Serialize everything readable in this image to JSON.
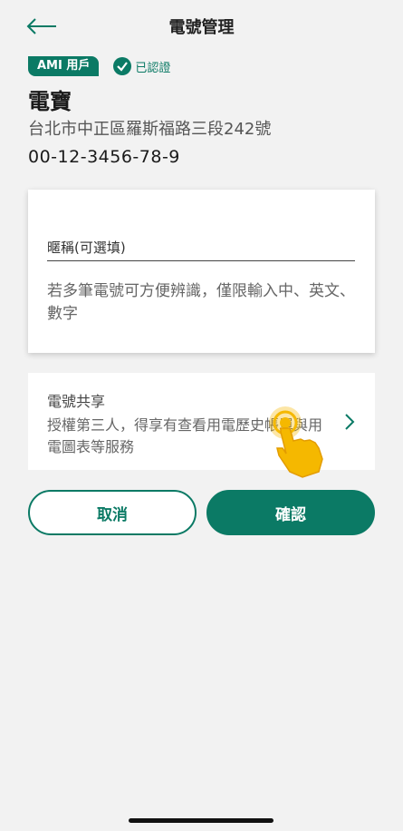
{
  "header": {
    "title": "電號管理"
  },
  "account": {
    "badge": "AMI 用戶",
    "verified_label": "已認證",
    "name": "電寶",
    "address": "台北市中正區羅斯福路三段242號",
    "number": "00-12-3456-78-9"
  },
  "nickname": {
    "placeholder": "暱稱(可選填)",
    "value": "",
    "hint": "若多筆電號可方便辨識，僅限輸入中、英文、數字"
  },
  "share": {
    "title": "電號共享",
    "description": "授權第三人，得享有查看用電歷史帳單與用電圖表等服務"
  },
  "actions": {
    "cancel_label": "取消",
    "confirm_label": "確認"
  },
  "colors": {
    "brand": "#0b7a65",
    "background": "#f2f2f2",
    "tap_hint": "#f5b800"
  },
  "icons": {
    "back": "back-arrow-icon",
    "verified": "check-circle-icon",
    "chevron": "chevron-right-icon",
    "tap_hint": "tap-hand-icon"
  }
}
